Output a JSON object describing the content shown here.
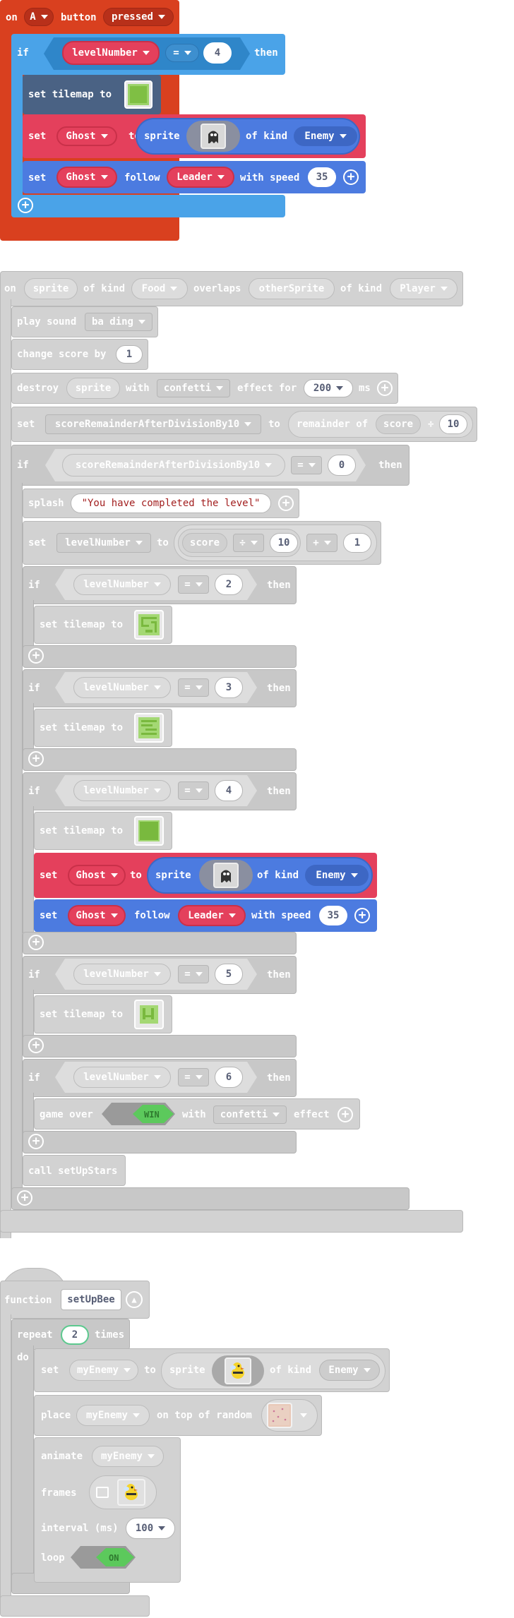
{
  "event1": {
    "on": "on",
    "button": "A",
    "button_word": "button",
    "state": "pressed",
    "if": "if",
    "var": "levelNumber",
    "op": "=",
    "value": "4",
    "then": "then",
    "set_tilemap": "set tilemap to",
    "set": "set",
    "ghost": "Ghost",
    "to": "to",
    "sprite": "sprite",
    "of_kind": "of kind",
    "enemy": "Enemy",
    "follow": "follow",
    "leader": "Leader",
    "with_speed": "with speed",
    "speed": "35"
  },
  "event2": {
    "on": "on",
    "sprite": "sprite",
    "of_kind": "of kind",
    "food": "Food",
    "overlaps": "overlaps",
    "other_sprite": "otherSprite",
    "player": "Player",
    "play_sound": "play sound",
    "sound": "ba ding",
    "change_score": "change score by",
    "score_delta": "1",
    "destroy": "destroy",
    "with": "with",
    "effect_name": "confetti",
    "effect_for": "effect for",
    "duration": "200",
    "ms": "ms",
    "set": "set",
    "remainder_var": "scoreRemainderAfterDivisionBy10",
    "to": "to",
    "remainder_of": "remainder of",
    "score": "score",
    "div": "÷",
    "divisor": "10",
    "if": "if",
    "eq": "=",
    "zero": "0",
    "then": "then",
    "splash": "splash",
    "splash_text": "\"You have completed the level\"",
    "level_var": "levelNumber",
    "plus": "+",
    "one": "1",
    "set_tilemap": "set tilemap to",
    "levels": [
      "2",
      "3",
      "4",
      "5",
      "6"
    ],
    "ghost": "Ghost",
    "sprite_word": "sprite",
    "enemy": "Enemy",
    "follow": "follow",
    "leader": "Leader",
    "with_speed": "with speed",
    "speed": "35",
    "game_over": "game over",
    "win": "WIN",
    "effect": "effect",
    "call": "call setUpStars"
  },
  "function_block": {
    "function": "function",
    "name": "setUpBee",
    "repeat": "repeat",
    "times_value": "2",
    "times": "times",
    "do": "do",
    "set": "set",
    "enemy_var": "myEnemy",
    "to": "to",
    "sprite": "sprite",
    "of_kind": "of kind",
    "enemy": "Enemy",
    "place": "place",
    "on_top": "on top of random",
    "animate": "animate",
    "frames": "frames",
    "interval": "interval (ms)",
    "interval_value": "100",
    "loop": "loop",
    "loop_value": "ON"
  }
}
